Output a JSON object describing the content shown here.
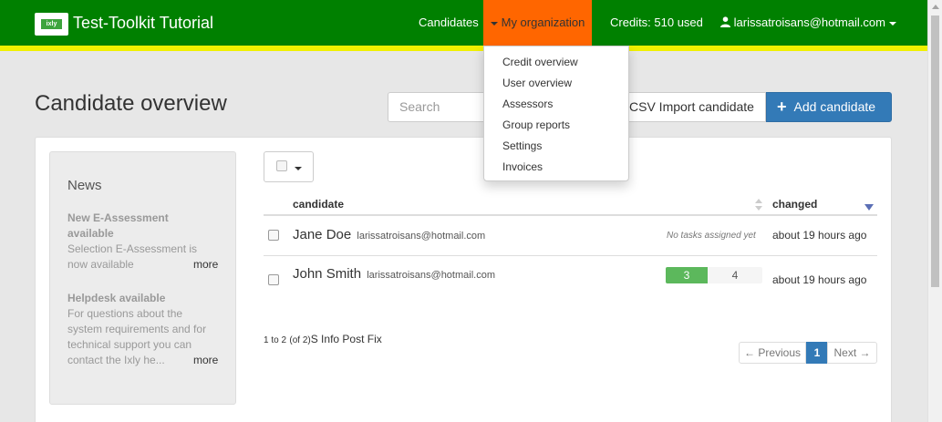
{
  "navbar": {
    "logo_text": "ixly",
    "brand": "Test-Toolkit Tutorial",
    "candidates": "Candidates",
    "my_organization": "My organization",
    "credits": "Credits: 510 used",
    "user_email": "larissatroisans@hotmail.com",
    "colors": {
      "bar": "#008000",
      "stripe": "#f0f000",
      "active": "#ff6600"
    }
  },
  "dropdown": {
    "items": [
      "Credit overview",
      "User overview",
      "Assessors",
      "Group reports",
      "Settings",
      "Invoices"
    ]
  },
  "page": {
    "title": "Candidate overview",
    "search_placeholder": "Search",
    "csv_import": "CSV Import candidate",
    "add_candidate": "Add candidate"
  },
  "news": {
    "title": "News",
    "items": [
      {
        "title": "New E-Assessment available",
        "body": "Selection E-Assessment is now available",
        "more": "more"
      },
      {
        "title": "Helpdesk available",
        "body": "For questions about the system requirements and for technical support you can contact the Ixly he...",
        "more": "more"
      }
    ]
  },
  "table": {
    "columns": {
      "candidate": "candidate",
      "changed": "changed"
    },
    "rows": [
      {
        "name": "Jane Doe",
        "email": "larissatroisans@hotmail.com",
        "tasks_text": "No tasks assigned yet",
        "changed": "about 19 hours ago"
      },
      {
        "name": "John Smith",
        "email": "larissatroisans@hotmail.com",
        "tasks_done": "3",
        "tasks_open": "4",
        "changed": "about 19 hours ago"
      }
    ],
    "info_range": "1 to 2",
    "info_total": "(of 2)",
    "info_suffix": "S Info Post Fix"
  },
  "pagination": {
    "previous": "← Previous",
    "current": "1",
    "next": "Next →"
  }
}
